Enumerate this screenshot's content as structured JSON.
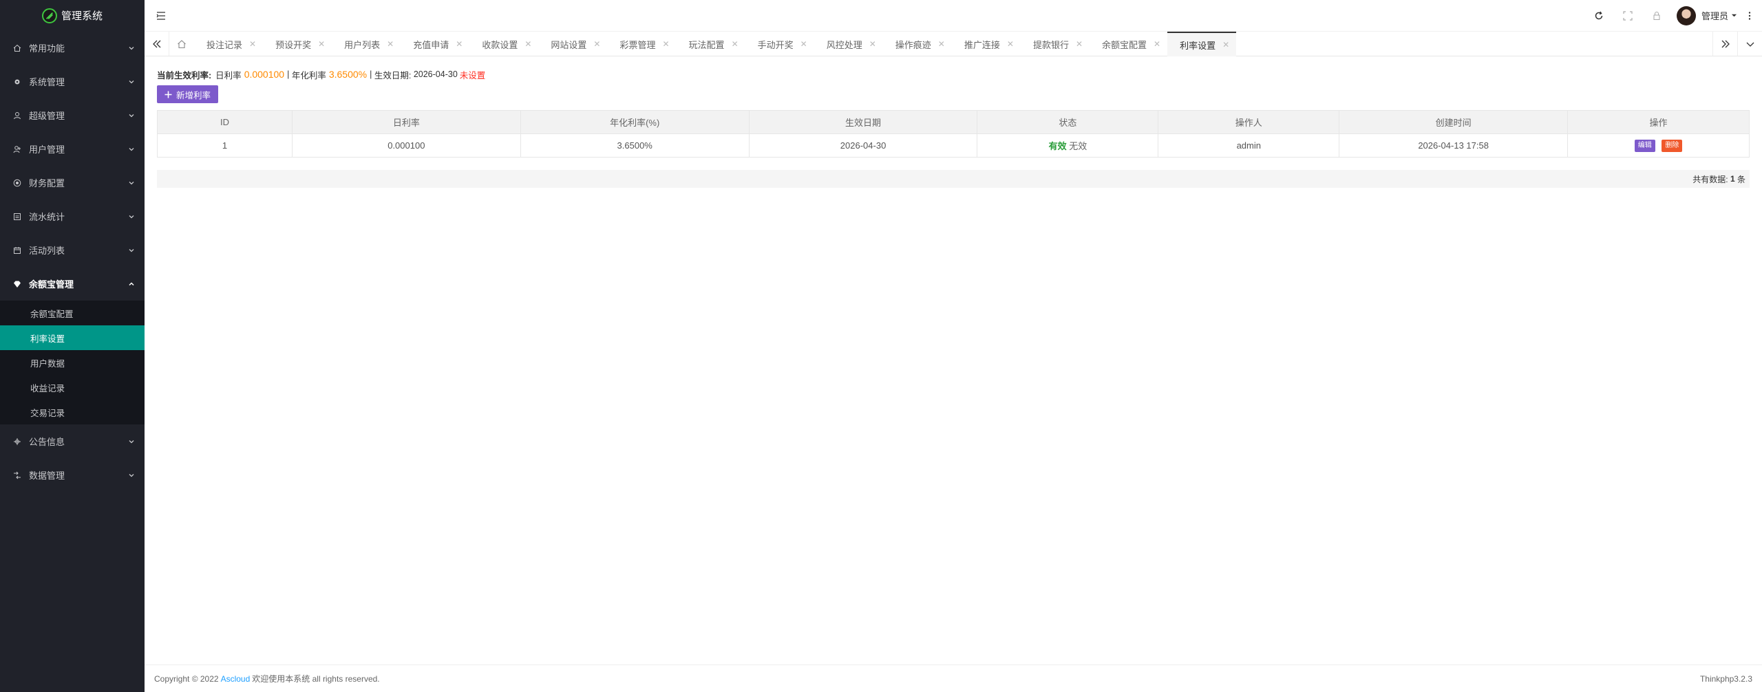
{
  "app": {
    "title": "管理系统"
  },
  "sidebar": {
    "items": [
      {
        "label": "常用功能",
        "icon": "home-icon"
      },
      {
        "label": "系统管理",
        "icon": "gear-icon"
      },
      {
        "label": "超级管理",
        "icon": "user-icon"
      },
      {
        "label": "用户管理",
        "icon": "users-icon"
      },
      {
        "label": "财务配置",
        "icon": "finance-icon"
      },
      {
        "label": "流水统计",
        "icon": "chart-icon"
      },
      {
        "label": "活动列表",
        "icon": "calendar-icon"
      },
      {
        "label": "余额宝管理",
        "icon": "diamond-icon"
      },
      {
        "label": "公告信息",
        "icon": "notice-icon"
      },
      {
        "label": "数据管理",
        "icon": "data-icon"
      }
    ],
    "sub_items": [
      "余额宝配置",
      "利率设置",
      "用户数据",
      "收益记录",
      "交易记录"
    ]
  },
  "header": {
    "user_name": "管理员"
  },
  "tabs": [
    "投注记录",
    "预设开奖",
    "用户列表",
    "充值申请",
    "收款设置",
    "网站设置",
    "彩票管理",
    "玩法配置",
    "手动开奖",
    "风控处理",
    "操作痕迹",
    "推广连接",
    "提款银行",
    "余额宝配置",
    "利率设置"
  ],
  "rate_info": {
    "label": "当前生效利率:",
    "daily_label": "日利率",
    "daily_value": "0.000100",
    "sep1": "|",
    "annual_label": "年化利率",
    "annual_value": "3.6500%",
    "sep2": "|",
    "date_label": "生效日期:",
    "date_value": "2026-04-30",
    "status": "未设置"
  },
  "add_button": {
    "label": "新增利率"
  },
  "table": {
    "headers": [
      "ID",
      "日利率",
      "年化利率(%)",
      "生效日期",
      "状态",
      "操作人",
      "创建时间",
      "操作"
    ],
    "rows": [
      {
        "id": "1",
        "daily": "0.000100",
        "annual": "3.6500%",
        "date": "2026-04-30",
        "status_valid": "有效",
        "status_invalid": "无效",
        "operator": "admin",
        "created": "2026-04-13 17:58",
        "edit": "编辑",
        "delete": "删除"
      }
    ]
  },
  "pager": {
    "prefix": "共有数据:",
    "count": "1",
    "suffix": "条"
  },
  "footer": {
    "copyright": "Copyright © 2022",
    "link": "Ascloud",
    "text": "欢迎使用本系统 all rights reserved.",
    "version": "Thinkphp3.2.3"
  },
  "colors": {
    "sidebar_bg": "#20222a",
    "active_sub": "#009688",
    "primary_btn": "#7d5acb",
    "danger_btn": "#f0582b",
    "rate_orange": "#ff8a00",
    "status_red": "#ff2d20",
    "valid_green": "#2a9d3a"
  }
}
